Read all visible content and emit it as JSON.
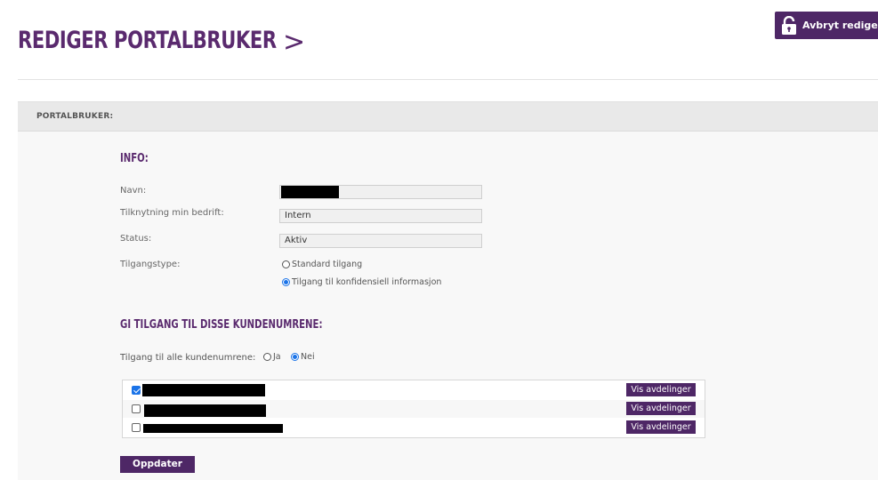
{
  "header": {
    "title": "REDIGER PORTALBRUKER",
    "chevron": ">",
    "cancel_label": "Avbryt redigering"
  },
  "panel": {
    "header_label": "PORTALBRUKER:",
    "info": {
      "title": "INFO:",
      "fields": [
        {
          "label": "Navn:",
          "value": ""
        },
        {
          "label": "Tilknytning min bedrift:",
          "value": "Intern"
        },
        {
          "label": "Status:",
          "value": "Aktiv"
        }
      ],
      "access_type": {
        "label": "Tilgangstype:",
        "options": [
          {
            "label": "Standard tilgang",
            "selected": false
          },
          {
            "label": "Tilgang til konfidensiell informasjon",
            "selected": true
          }
        ]
      }
    },
    "customers": {
      "title": "GI TILGANG TIL DISSE KUNDENUMRENE:",
      "all_label": "Tilgang til alle kundenumrene:",
      "all_options": [
        {
          "label": "Ja",
          "selected": false
        },
        {
          "label": "Nei",
          "selected": true
        }
      ],
      "rows": [
        {
          "checked": true,
          "button_label": "Vis avdelinger"
        },
        {
          "checked": false,
          "button_label": "Vis avdelinger"
        },
        {
          "checked": false,
          "button_label": "Vis avdelinger"
        }
      ]
    },
    "update_label": "Oppdater"
  },
  "colors": {
    "brand_purple": "#4e2766",
    "title_purple": "#5a2a6e",
    "check_blue": "#1a73e8"
  },
  "icons": {
    "cancel_button": "lock-icon"
  }
}
